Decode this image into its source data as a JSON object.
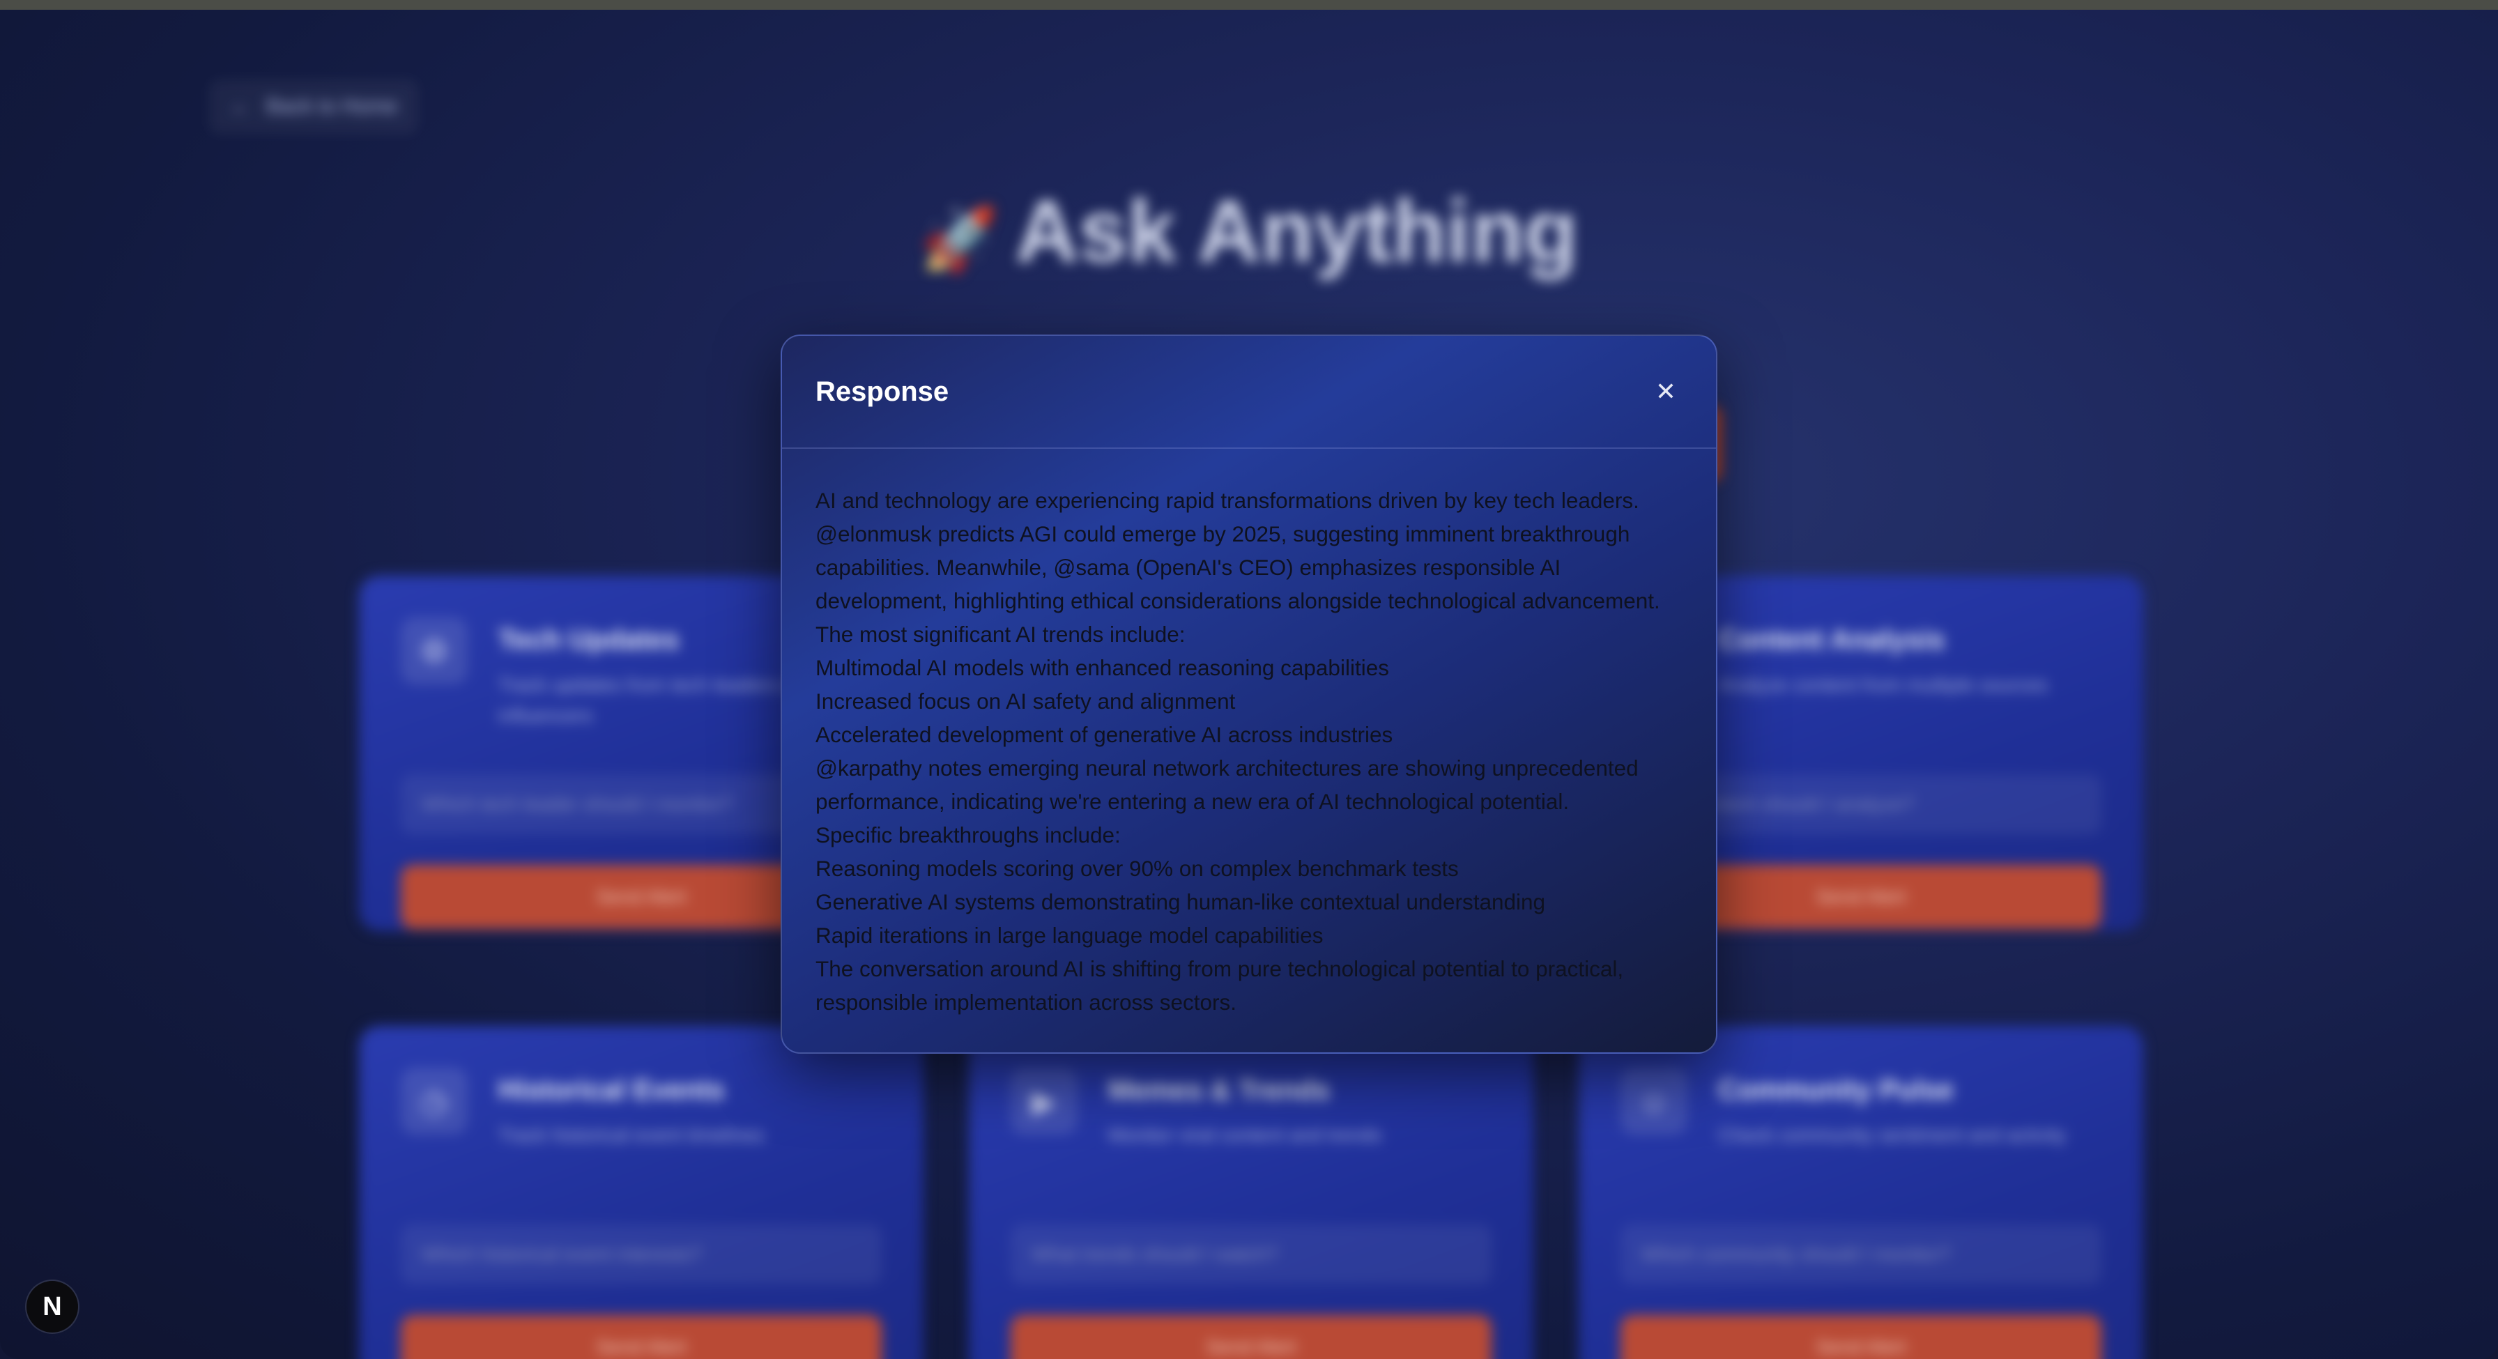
{
  "background": {
    "back_link": "Back to Home",
    "hero_title": "Ask Anything",
    "hero_emoji": "🚀",
    "cards": [
      {
        "title": "Tech Updates",
        "desc": "Track updates from tech leaders & influencers",
        "placeholder": "Which tech leader should I monitor?",
        "button": "Send Alert",
        "icon": "gear-icon"
      },
      {
        "title": "Content Analysis",
        "desc": "Analyze content from multiple sources",
        "placeholder": "What content should I analyze?",
        "button": "Send Alert",
        "icon": "chart-icon"
      },
      {
        "title": "Historical Events",
        "desc": "Track historical event timelines",
        "placeholder": "Which historical event interests?",
        "button": "Send Alert",
        "icon": "clock-icon"
      },
      {
        "title": "Memes & Trends",
        "desc": "Monitor viral content and trends",
        "placeholder": "What trends should I watch?",
        "button": "Send Alert",
        "icon": "play-icon"
      },
      {
        "title": "Community Pulse",
        "desc": "Check community sentiment and activity",
        "placeholder": "Which community should I monitor?",
        "button": "Send Alert",
        "icon": "people-icon"
      }
    ]
  },
  "modal": {
    "title": "Response",
    "close_icon": "close-icon",
    "lines": [
      "AI and technology are experiencing rapid transformations driven by key tech leaders.",
      "@elonmusk predicts AGI could emerge by 2025, suggesting imminent breakthrough",
      "capabilities. Meanwhile, @sama (OpenAI's CEO) emphasizes responsible AI",
      "development, highlighting ethical considerations alongside technological advancement.",
      "The most significant AI trends include:",
      "Multimodal AI models with enhanced reasoning capabilities",
      "Increased focus on AI safety and alignment",
      "Accelerated development of generative AI across industries",
      "@karpathy notes emerging neural network architectures are showing unprecedented",
      "performance, indicating we're entering a new era of AI technological potential.",
      "Specific breakthroughs include:",
      "Reasoning models scoring over 90% on complex benchmark tests",
      "Generative AI systems demonstrating human-like contextual understanding",
      "Rapid iterations in large language model capabilities",
      "The conversation around AI is shifting from pure technological potential to practical,",
      "responsible implementation across sectors."
    ]
  },
  "badge": {
    "label": "N"
  }
}
